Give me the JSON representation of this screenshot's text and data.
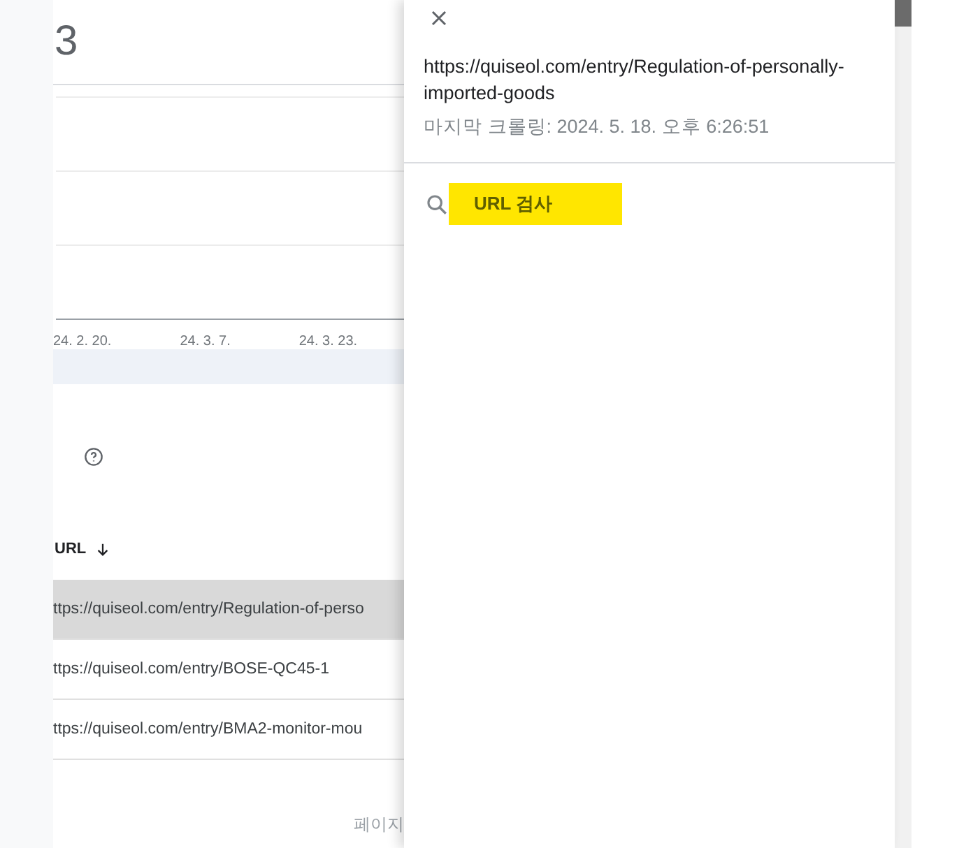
{
  "main": {
    "title": "3",
    "chart": {
      "x_labels": [
        "24. 2. 20.",
        "24. 3. 7.",
        "24. 3. 23."
      ]
    },
    "table": {
      "column": {
        "label": "URL",
        "sorted_descending": true
      },
      "rows": [
        {
          "url": "ttps://quiseol.com/entry/Regulation-of-perso",
          "selected": true
        },
        {
          "url": "ttps://quiseol.com/entry/BOSE-QC45-1",
          "selected": false
        },
        {
          "url": "ttps://quiseol.com/entry/BMA2-monitor-mou",
          "selected": false
        }
      ]
    },
    "footer": "페이지"
  },
  "panel": {
    "url": "https://quiseol.com/entry/Regulation-of-personally-imported-goods",
    "last_crawl": "마지막 크롤링: 2024. 5. 18. 오후 6:26:51",
    "inspect_button": "URL 검사"
  }
}
